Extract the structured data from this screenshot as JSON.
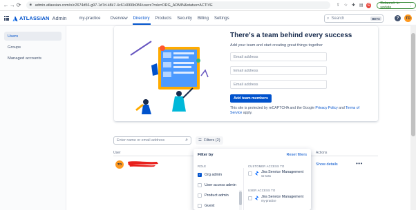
{
  "browser": {
    "url": "admin.atlassian.com/o/c2674d56-g97-1d7d-k8k7-4c614066b084/users?role=ORG_ADMIN&status=ACTIVE",
    "profile_initial": "C",
    "relaunch_label": "Relaunch to update"
  },
  "header": {
    "brand": "ATLASSIAN",
    "brand_sub": "Admin",
    "org": "my-practice",
    "nav": [
      "Overview",
      "Directory",
      "Products",
      "Security",
      "Billing",
      "Settings"
    ],
    "active_nav": "Directory",
    "search_placeholder": "Search",
    "search_badge": "BETA",
    "help": "?",
    "avatar_initials": "TD"
  },
  "sidebar": {
    "items": [
      {
        "label": "Users",
        "active": true
      },
      {
        "label": "Groups",
        "active": false
      },
      {
        "label": "Managed accounts",
        "active": false
      }
    ]
  },
  "banner": {
    "title": "There's a team behind every success",
    "subtitle": "Add your team and start creating great things together",
    "email_placeholder": "Email address",
    "add_button": "Add team members",
    "captcha_prefix": "This site is protected by reCAPTCHA and the Google ",
    "privacy_link": "Privacy Policy",
    "captcha_mid": " and ",
    "terms_link": "Terms of Service",
    "captcha_suffix": " apply."
  },
  "toolbar": {
    "search_placeholder": "Enter name or email address",
    "filters_label": "Filters (2)"
  },
  "table": {
    "col_user": "User",
    "col_actions": "Actions",
    "rows": [
      {
        "avatar": "TD",
        "action": "Show details",
        "more": "•••"
      }
    ]
  },
  "filter_panel": {
    "title": "Filter by",
    "reset": "Reset filters",
    "role_heading": "ROLE",
    "roles": [
      {
        "label": "Org admin",
        "checked": true
      },
      {
        "label": "User access admin",
        "checked": false
      },
      {
        "label": "Product admin",
        "checked": false
      },
      {
        "label": "Guest",
        "checked": false
      }
    ],
    "customer_heading": "CUSTOMER ACCESS TO",
    "customer_products": [
      {
        "name": "Jira Service Management",
        "site": "ss-ssss"
      }
    ],
    "user_heading": "USER ACCESS TO",
    "user_products": [
      {
        "name": "Jira Service Management",
        "site": "my-practice"
      }
    ]
  },
  "colors": {
    "accent": "#0052cc",
    "avatar": "#ff991f",
    "redaction": "#e8201c"
  }
}
